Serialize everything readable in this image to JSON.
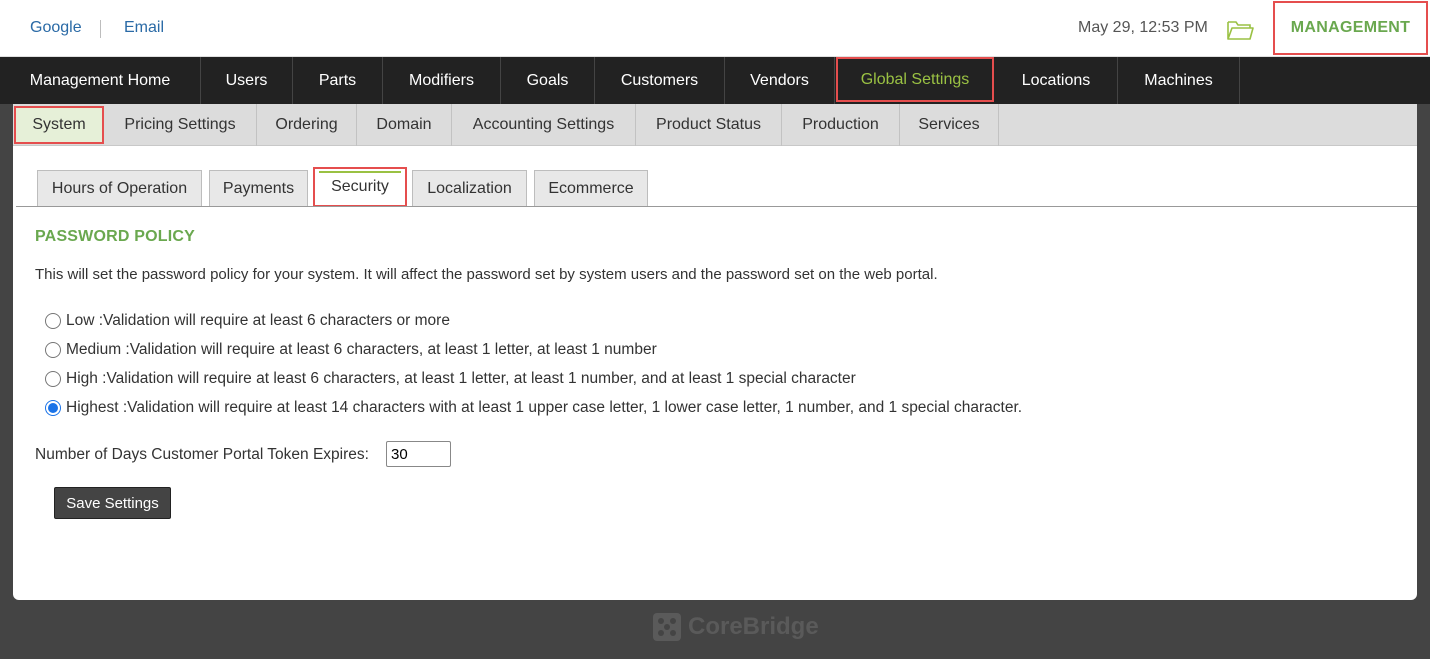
{
  "topbar": {
    "links": {
      "google": "Google",
      "email": "Email"
    },
    "datetime": "May 29, 12:53 PM",
    "icons": {
      "folder": "folder-open-icon"
    },
    "management_label": "MANAGEMENT"
  },
  "main_nav": {
    "items": [
      {
        "label": "Management Home"
      },
      {
        "label": "Users"
      },
      {
        "label": "Parts"
      },
      {
        "label": "Modifiers"
      },
      {
        "label": "Goals"
      },
      {
        "label": "Customers"
      },
      {
        "label": "Vendors"
      },
      {
        "label": "Global Settings",
        "active": true
      },
      {
        "label": "Locations"
      },
      {
        "label": "Machines"
      }
    ]
  },
  "sub_nav": {
    "items": [
      {
        "label": "System",
        "active": true
      },
      {
        "label": "Pricing Settings"
      },
      {
        "label": "Ordering"
      },
      {
        "label": "Domain"
      },
      {
        "label": "Accounting Settings"
      },
      {
        "label": "Product Status"
      },
      {
        "label": "Production"
      },
      {
        "label": "Services"
      }
    ]
  },
  "tabs": {
    "items": [
      {
        "label": "Hours of Operation"
      },
      {
        "label": "Payments"
      },
      {
        "label": "Security",
        "active": true
      },
      {
        "label": "Localization"
      },
      {
        "label": "Ecommerce"
      }
    ]
  },
  "password_policy": {
    "heading": "PASSWORD POLICY",
    "description": "This will set the password policy for your system. It will affect the password set by system users and the password set on the web portal.",
    "options": [
      {
        "label": "Low :Validation will require at least 6 characters or more",
        "checked": false
      },
      {
        "label": "Medium :Validation will require at least 6 characters, at least 1 letter, at least 1 number",
        "checked": false
      },
      {
        "label": "High :Validation will require at least 6 characters, at least 1 letter, at least 1 number, and at least 1 special character",
        "checked": false
      },
      {
        "label": "Highest :Validation will require at least 14 characters with at least 1 upper case letter, 1 lower case letter, 1 number, and 1 special character.",
        "checked": true
      }
    ]
  },
  "token": {
    "label": "Number of Days Customer Portal Token Expires:",
    "value": "30"
  },
  "save_button": "Save Settings",
  "footer": {
    "brand": "CoreBridge"
  },
  "colors": {
    "accent_green": "#6aa84f",
    "nav_active": "#9ac143",
    "highlight_red": "#e54e4e",
    "nav_bg": "#222222",
    "page_bg": "#444444"
  }
}
